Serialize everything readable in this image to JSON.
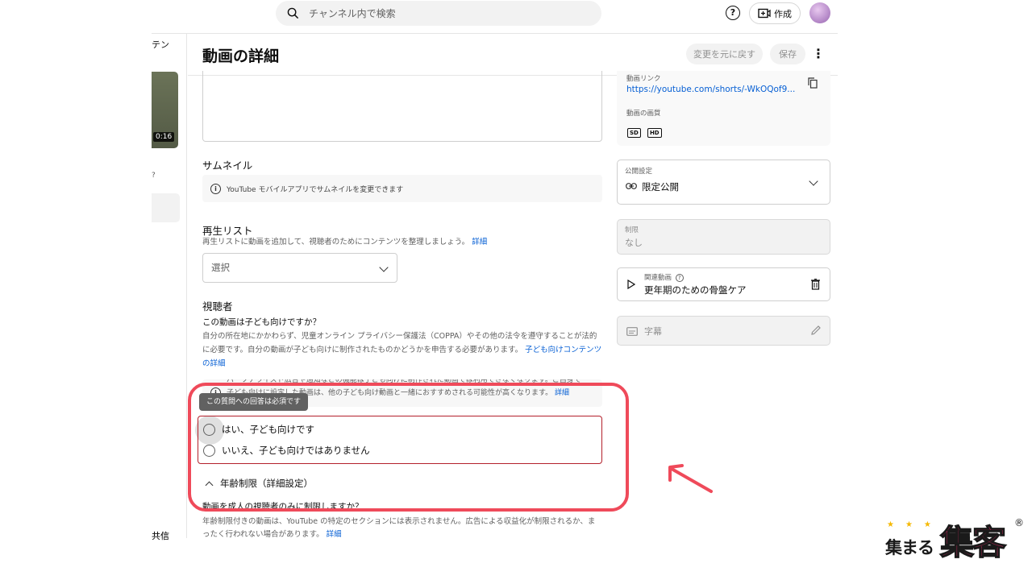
{
  "topbar": {
    "search_placeholder": "チャンネル内で検索",
    "create_label": "作成"
  },
  "sidebar": {
    "item_top": "テン",
    "duration": "0:16",
    "item_mid": "?",
    "item_bottom": "共信"
  },
  "header": {
    "title": "動画の詳細",
    "revert_label": "変更を元に戻す",
    "save_label": "保存"
  },
  "thumbnail": {
    "title": "サムネイル",
    "info": "YouTube モバイルアプリでサムネイルを変更できます"
  },
  "playlist": {
    "title": "再生リスト",
    "description": "再生リストに動画を追加して、視聴者のためにコンテンツを整理しましょう。",
    "link": "詳細",
    "select_label": "選択"
  },
  "audience": {
    "title": "視聴者",
    "question": "この動画は子ども向けですか？",
    "body": "自分の所在地にかかわらず、児童オンライン プライバシー保護法（COPPA）やその他の法令を遵守することが法的に必要です。自分の動画が子ども向けに制作されたものかどうかを申告する必要があります。",
    "body_link": "子ども向けコンテンツの詳細",
    "ad_note_line1": "パーソナライズド広告や通知などの機能は子ども向けに制作された動画では利用できなくなります。ご自身で",
    "ad_note_line2": "子ども向けに設定した動画は、他の子ども向け動画と一緒におすすめされる可能性が高くなります。",
    "ad_note_link": "詳細",
    "tooltip": "この質問への回答は必須です",
    "option_yes": "はい、子ども向けです",
    "option_no": "いいえ、子ども向けではありません"
  },
  "age_restriction": {
    "title": "年齢制限（詳細設定）",
    "question": "動画を成人の視聴者のみに制限しますか？",
    "body": "年齢制限付きの動画は、YouTube の特定のセクションには表示されません。広告による収益化が制限されるか、まったく行われない場合があります。",
    "link": "詳細"
  },
  "right_panel": {
    "video_link_label": "動画リンク",
    "video_link": "https://youtube.com/shorts/-WkOQof9...",
    "quality_label": "動画の画質",
    "quality_badges": [
      "SD",
      "HD"
    ],
    "visibility_label": "公開設定",
    "visibility_value": "限定公開",
    "restriction_label": "制限",
    "restriction_value": "なし",
    "related_label": "関連動画",
    "related_value": "更年期のための骨盤ケア",
    "subtitles_label": "字幕"
  },
  "logo": {
    "small": "集まる",
    "big": "集客",
    "mark": "®"
  },
  "colors": {
    "highlight": "#ef4a5a",
    "radio_error": "#b3202b",
    "link": "#065fd4",
    "logo_pink": "#ef2c6a"
  }
}
